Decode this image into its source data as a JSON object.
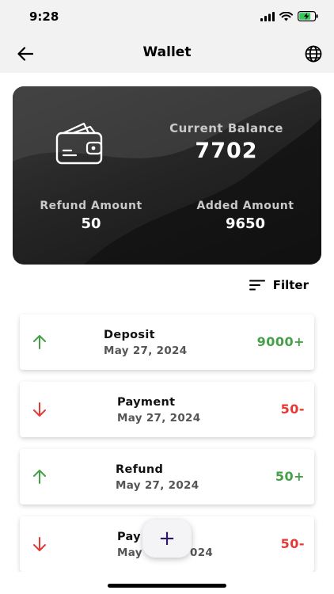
{
  "status_bar": {
    "time": "9:28"
  },
  "nav": {
    "title": "Wallet",
    "back_icon": "arrow-left-icon",
    "language_icon": "globe-icon"
  },
  "card": {
    "current_balance_label": "Current Balance",
    "current_balance_value": "7702",
    "refund_label": "Refund Amount",
    "refund_value": "50",
    "added_label": "Added Amount",
    "added_value": "9650"
  },
  "filter": {
    "label": "Filter"
  },
  "transactions": [
    {
      "title": "Deposit",
      "date": "May 27, 2024",
      "amount": "9000+",
      "direction": "up"
    },
    {
      "title": "Payment",
      "date": "May 27, 2024",
      "amount": "50-",
      "direction": "down"
    },
    {
      "title": "Refund",
      "date": "May 27, 2024",
      "amount": "50+",
      "direction": "up"
    },
    {
      "title": "Pay",
      "date": "May",
      "date_tail": "024",
      "amount": "50-",
      "direction": "down"
    }
  ],
  "fab": {
    "symbol": "+"
  },
  "colors": {
    "positive": "#43a047",
    "negative": "#e53935",
    "accent": "#2d1a66"
  }
}
